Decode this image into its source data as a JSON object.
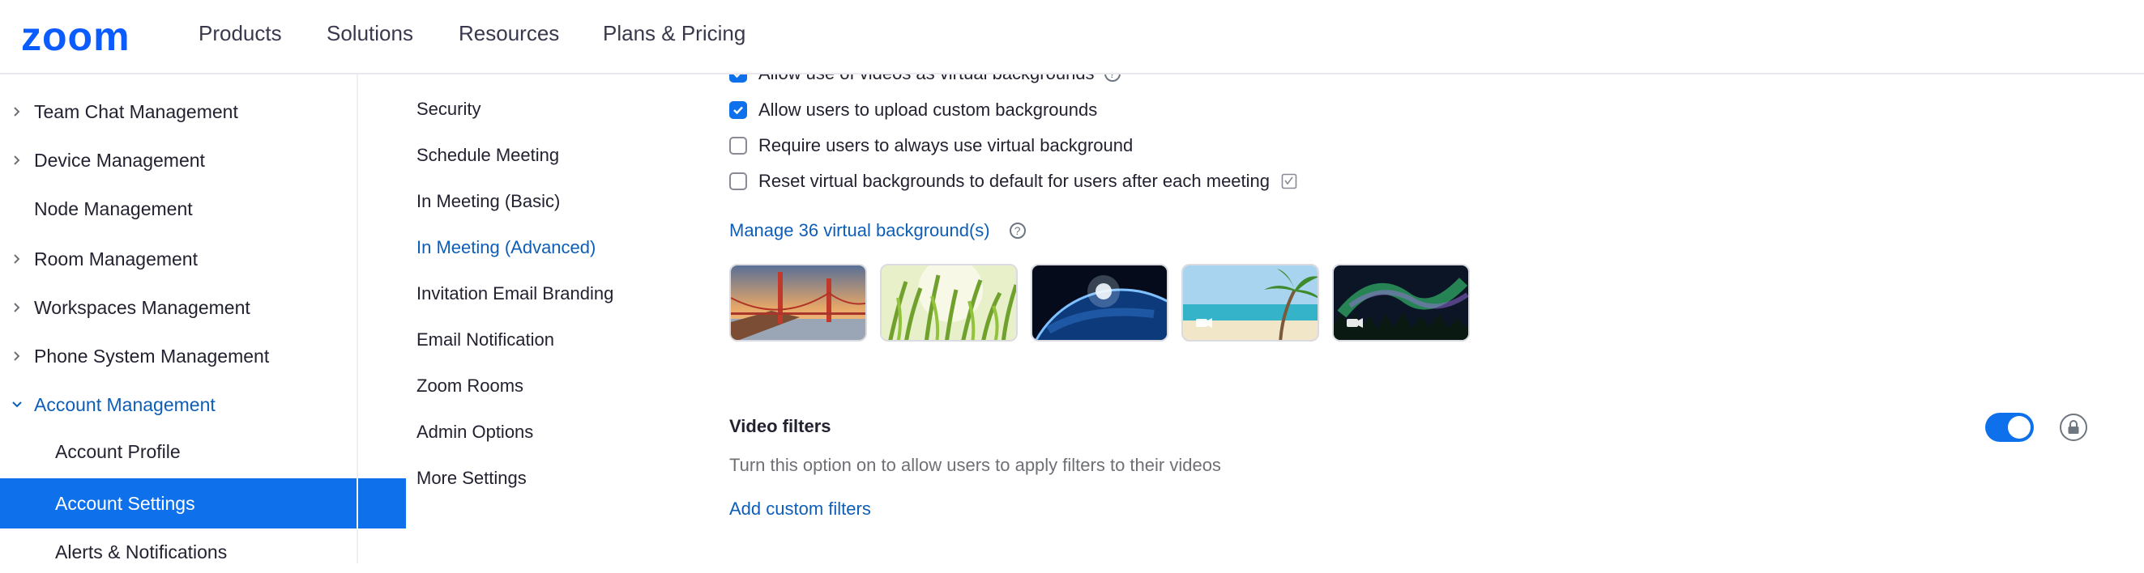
{
  "header": {
    "logo": "zoom",
    "nav": [
      "Products",
      "Solutions",
      "Resources",
      "Plans & Pricing"
    ]
  },
  "sidebar": {
    "items": [
      {
        "label": "Team Chat Management",
        "chevron": "right"
      },
      {
        "label": "Device Management",
        "chevron": "right"
      },
      {
        "label": "Node Management",
        "chevron": "none"
      },
      {
        "label": "Room Management",
        "chevron": "right"
      },
      {
        "label": "Workspaces Management",
        "chevron": "right"
      },
      {
        "label": "Phone System Management",
        "chevron": "right"
      },
      {
        "label": "Account Management",
        "chevron": "down",
        "state": "expanded"
      },
      {
        "label": "Account Profile",
        "sub": true
      },
      {
        "label": "Account Settings",
        "sub": true,
        "state": "active"
      },
      {
        "label": "Alerts & Notifications",
        "sub": true
      }
    ]
  },
  "settings_nav": {
    "items": [
      "Security",
      "Schedule Meeting",
      "In Meeting (Basic)",
      "In Meeting (Advanced)",
      "Invitation Email Branding",
      "Email Notification",
      "Zoom Rooms",
      "Admin Options",
      "More Settings"
    ],
    "active_index": 3
  },
  "virtual_background": {
    "options": [
      {
        "label": "Allow use of videos as virtual backgrounds",
        "checked": true,
        "help": true
      },
      {
        "label": "Allow users to upload custom backgrounds",
        "checked": true
      },
      {
        "label": "Require users to always use virtual background",
        "checked": false
      },
      {
        "label": "Reset virtual backgrounds to default for users after each meeting",
        "checked": false,
        "info_icon": true
      }
    ],
    "manage_link": "Manage 36 virtual background(s)",
    "thumbnails": [
      "golden-gate-bridge",
      "grass",
      "earth-from-space",
      "beach-palm-tree",
      "northern-lights"
    ]
  },
  "video_filters": {
    "title": "Video filters",
    "description": "Turn this option on to allow users to apply filters to their videos",
    "link": "Add custom filters",
    "enabled": true
  },
  "colors": {
    "accent": "#0e71eb",
    "link": "#0e5eb8",
    "brand": "#0b5cff"
  }
}
